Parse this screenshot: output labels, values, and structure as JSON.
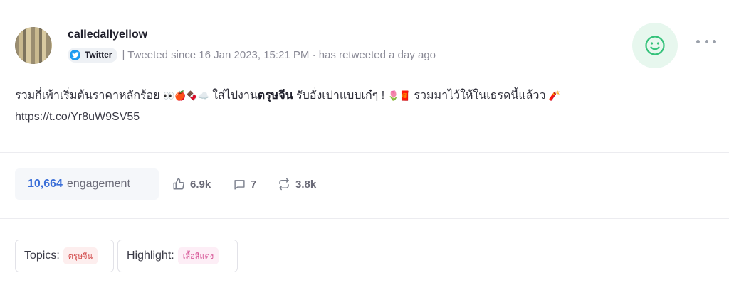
{
  "post": {
    "username": "calledallyellow",
    "platform": "Twitter",
    "meta": "| Tweeted since 16 Jan 2023, 15:21 PM · has retweeted a day ago",
    "text_before": "รวมกี่เพ้าเริ่มต้นราคาหลักร้อย ",
    "text_emojis_1": "👀🍎🍫☁️",
    "text_middle_plain": " ใส่ไปงาน",
    "text_bold": "ตรุษจีน",
    "text_after": " รับอั่งเปาแบบเก๋ๆ ! ",
    "text_emojis_2": "🌷🧧",
    "text_end": " รวมมาไว้ให้ในเธรดนี้แล้วว ",
    "text_emojis_3": "🧨",
    "link": "https://t.co/Yr8uW9SV55"
  },
  "metrics": {
    "engagement_value": "10,664",
    "engagement_label": "engagement",
    "likes": "6.9k",
    "comments": "7",
    "retweets": "3.8k"
  },
  "tags": {
    "topics_label": "Topics:",
    "topics_value": "ตรุษจีน",
    "highlight_label": "Highlight:",
    "highlight_value": "เสื้อสีแดง"
  },
  "icons": {
    "platform": "twitter-bird-icon",
    "sentiment": "smiley-face-icon",
    "more": "more-dots-icon",
    "like": "thumbs-up-icon",
    "comment": "comment-bubble-icon",
    "retweet": "retweet-icon"
  },
  "colors": {
    "twitter_blue": "#1d9bf0",
    "sentiment_bg": "#e7f7ee",
    "sentiment_green": "#34c27a",
    "engagement_blue": "#3b6fd8",
    "topic_pill_bg": "#fdeeee",
    "topic_pill_text": "#d24b4b",
    "highlight_pill_bg": "#fdeef6",
    "highlight_pill_text": "#d4498f"
  }
}
